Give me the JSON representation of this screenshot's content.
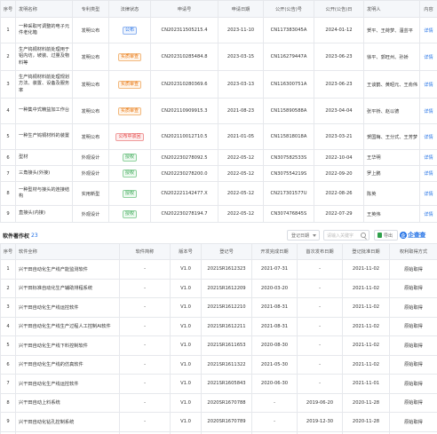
{
  "patents": {
    "headers": [
      "序号",
      "发明名称",
      "专利类型",
      "法律状态",
      "申请号",
      "申请日期",
      "公开(公告)号",
      "公开(公告)日",
      "发明人",
      "内容"
    ],
    "rows": [
      {
        "no": "1",
        "name": "一种采取可调整的电子元件老化箱",
        "type": "发明公布",
        "status": "公布",
        "status_color": "blue",
        "app_no": "CN202311505215.4",
        "app_date": "2023-11-10",
        "pub_no": "CN117383045A",
        "pub_date": "2024-01-12",
        "inventors": "贺平、王荷梦、温芸平",
        "detail": "详情"
      },
      {
        "no": "2",
        "name": "生产钨铜材料前处理用于铝内坊，坡装、过量及物料等",
        "type": "发明公布",
        "status": "实质审查",
        "status_color": "orange",
        "app_no": "CN202310285484.8",
        "app_date": "2023-03-15",
        "pub_no": "CN116279447A",
        "pub_date": "2023-06-23",
        "inventors": "徐平、郭旺州、孙娇",
        "detail": "详情"
      },
      {
        "no": "3",
        "name": "生产钨铜材料前处理规划方法、装置、设备及服务率",
        "type": "发明公布",
        "status": "实质审查",
        "status_color": "orange",
        "app_no": "CN202310280369.6",
        "app_date": "2023-03-13",
        "pub_no": "CN116300751A",
        "pub_date": "2023-06-23",
        "inventors": "王谈鹤、黄昭元、王俞伟",
        "detail": "详情"
      },
      {
        "no": "4",
        "name": "一种集中式精益加工作台",
        "type": "发明公布",
        "status": "实质审查",
        "status_color": "orange",
        "app_no": "CN202110909915.3",
        "app_date": "2021-08-23",
        "pub_no": "CN115890588A",
        "pub_date": "2023-04-04",
        "inventors": "张平桥、赵以德",
        "detail": "详情"
      },
      {
        "no": "5",
        "name": "一种生产钨铜材料的装置",
        "type": "发明公布",
        "status": "公布中驳回",
        "status_color": "red",
        "app_no": "CN202110012710.5",
        "app_date": "2021-01-05",
        "pub_no": "CN115818018A",
        "pub_date": "2023-03-21",
        "inventors": "贺国梅、王分式、王芳梦",
        "detail": "详情"
      },
      {
        "no": "6",
        "name": "型材",
        "type": "外观设计",
        "status": "授权",
        "status_color": "green",
        "app_no": "CN202230278092.5",
        "app_date": "2022-05-12",
        "pub_no": "CN307582533S",
        "pub_date": "2022-10-04",
        "inventors": "王华明",
        "detail": "详情"
      },
      {
        "no": "7",
        "name": "三角接头(外接)",
        "type": "外观设计",
        "status": "授权",
        "status_color": "green",
        "app_no": "CN202230278200.0",
        "app_date": "2022-05-12",
        "pub_no": "CN307554219S",
        "pub_date": "2022-09-20",
        "inventors": "罗上鹏",
        "detail": "详情"
      },
      {
        "no": "8",
        "name": "一种型材与接头的连接结构",
        "type": "实用新型",
        "status": "授权",
        "status_color": "green",
        "app_no": "CN202221142477.X",
        "app_date": "2022-05-12",
        "pub_no": "CN217301577U",
        "pub_date": "2022-08-26",
        "inventors": "陈英",
        "detail": "详情"
      },
      {
        "no": "9",
        "name": "直接头(内接)",
        "type": "外观设计",
        "status": "授权",
        "status_color": "green",
        "app_no": "CN202230278194.7",
        "app_date": "2022-05-12",
        "pub_no": "CN307476845S",
        "pub_date": "2022-07-29",
        "inventors": "王英伟",
        "detail": "详情"
      }
    ]
  },
  "software_section": {
    "title": "软件著作权",
    "count": "23",
    "sort_label": "登记日期",
    "search_placeholder": "请输入关键字",
    "export_label": "导出",
    "brand_logo": "企",
    "brand_name": "企查查"
  },
  "software": {
    "headers": [
      "序号",
      "软件全称",
      "软件简称",
      "版本号",
      "登记号",
      "开发完成日期",
      "首次发布日期",
      "登记批准日期",
      "权利取得方式"
    ],
    "rows": [
      {
        "no": "1",
        "name": "兴干田自动化生产线产能监测软件",
        "short": "-",
        "version": "V1.0",
        "reg_no": "2021SR1612323",
        "dev_date": "2021-07-31",
        "pub_date": "-",
        "approve_date": "2021-11-02",
        "method": "原始取得"
      },
      {
        "no": "2",
        "name": "兴干田标准自动化生产辅助排程系统",
        "short": "-",
        "version": "V1.0",
        "reg_no": "2021SR1612209",
        "dev_date": "2020-03-20",
        "pub_date": "-",
        "approve_date": "2021-11-02",
        "method": "原始取得"
      },
      {
        "no": "3",
        "name": "兴干田自动化生产线运控软件",
        "short": "-",
        "version": "V1.0",
        "reg_no": "2021SR1612210",
        "dev_date": "2021-08-31",
        "pub_date": "-",
        "approve_date": "2021-11-02",
        "method": "原始取得"
      },
      {
        "no": "4",
        "name": "兴干田自动化生产线生产过程人工控制AI软件",
        "short": "-",
        "version": "V1.0",
        "reg_no": "2021SR1612211",
        "dev_date": "2021-08-31",
        "pub_date": "-",
        "approve_date": "2021-11-02",
        "method": "原始取得"
      },
      {
        "no": "5",
        "name": "兴干田自动化生产线下料控制软件",
        "short": "-",
        "version": "V1.0",
        "reg_no": "2021SR1611653",
        "dev_date": "2020-08-30",
        "pub_date": "-",
        "approve_date": "2021-11-02",
        "method": "原始取得"
      },
      {
        "no": "6",
        "name": "兴干田自动化生产线的仿真软件",
        "short": "-",
        "version": "V1.0",
        "reg_no": "2021SR1611322",
        "dev_date": "2021-05-30",
        "pub_date": "-",
        "approve_date": "2021-11-02",
        "method": "原始取得"
      },
      {
        "no": "7",
        "name": "兴干田自动化生产线运控软件",
        "short": "-",
        "version": "V1.0",
        "reg_no": "2021SR1605843",
        "dev_date": "2020-06-30",
        "pub_date": "-",
        "approve_date": "2021-11-01",
        "method": "原始取得"
      },
      {
        "no": "8",
        "name": "兴干田自动上料系统",
        "short": "-",
        "version": "V1.0",
        "reg_no": "2020SR1670788",
        "dev_date": "-",
        "pub_date": "2019-06-20",
        "approve_date": "2020-11-28",
        "method": "原始取得"
      },
      {
        "no": "9",
        "name": "兴干田自动化钻孔控制系统",
        "short": "-",
        "version": "V1.0",
        "reg_no": "2020SR1670789",
        "dev_date": "-",
        "pub_date": "2019-12-30",
        "approve_date": "2020-11-28",
        "method": "原始取得"
      },
      {
        "no": "10",
        "name": "兴干田自动包装生产线控制系统",
        "short": "-",
        "version": "V1.0",
        "reg_no": "2020SR1670755",
        "dev_date": "-",
        "pub_date": "2019-12-30",
        "approve_date": "2020-11-28",
        "method": "原始取得"
      }
    ]
  }
}
